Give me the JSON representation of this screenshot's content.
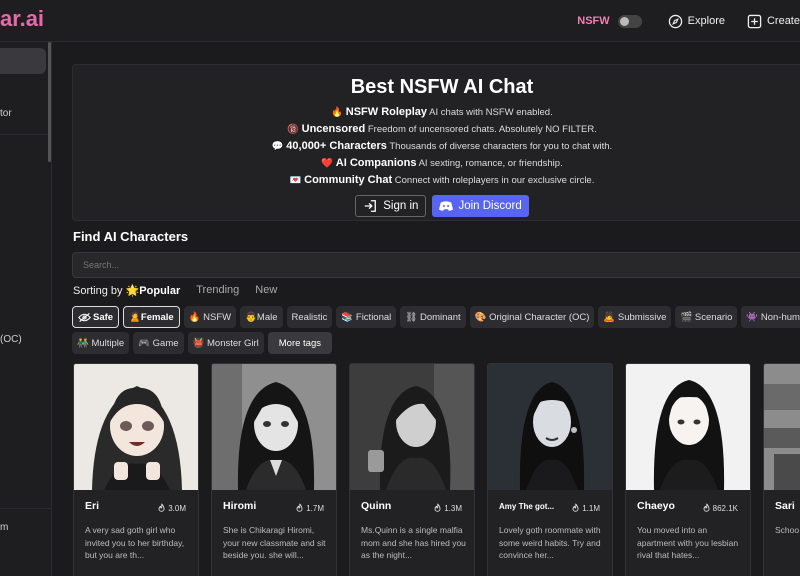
{
  "brand": {
    "logo_text": "ar.ai"
  },
  "topbar": {
    "nsfw_label": "NSFW",
    "explore_label": "Explore",
    "create_label": "Create"
  },
  "sidebar": {
    "label_1": "tor",
    "label_2": "(OC)",
    "label_3": "m"
  },
  "hero": {
    "title": "Best NSFW AI Chat",
    "features": [
      {
        "emoji": "🔥",
        "title": "NSFW Roleplay",
        "desc": "AI chats with NSFW enabled."
      },
      {
        "emoji": "🔞",
        "title": "Uncensored",
        "desc": "Freedom of uncensored chats. Absolutely NO FILTER."
      },
      {
        "emoji": "💬",
        "title": "40,000+ Characters",
        "desc": "Thousands of diverse characters for you to chat with."
      },
      {
        "emoji": "❤️",
        "title": "AI Companions",
        "desc": "AI sexting, romance, or friendship."
      },
      {
        "emoji": "💌",
        "title": "Community Chat",
        "desc": "Connect with roleplayers in our exclusive circle."
      }
    ],
    "signin_label": "Sign in",
    "discord_label": "Join Discord"
  },
  "find": {
    "title": "Find AI Characters",
    "search_placeholder": "Search..."
  },
  "sorting": {
    "prefix": "Sorting by",
    "active": "🌟Popular",
    "options": [
      "Trending",
      "New"
    ]
  },
  "tags_row1": [
    "Safe",
    "🙎Female",
    "🔥 NSFW",
    "👨Male",
    "Realistic",
    "📚 Fictional",
    "⛓ Dominant",
    "🎨 Original Character (OC)",
    "🙇 Submissive",
    "🎬 Scenario",
    "👾 Non-human"
  ],
  "tags_row2": [
    "👬 Multiple",
    "🎮 Game",
    "👹 Monster Girl"
  ],
  "more_tags_label": "More tags",
  "cards": [
    {
      "name": "Eri",
      "count": "3.0M",
      "desc": "A very sad goth girl who invited you to her birthday, but you are th..."
    },
    {
      "name": "Hiromi",
      "count": "1.7M",
      "desc": "She is Chikaragi Hiromi, your new classmate and sit beside you. she will..."
    },
    {
      "name": "Quinn",
      "count": "1.3M",
      "desc": "Ms.Quinn is a single malfia mom and she has hired you as the night..."
    },
    {
      "name": "Amy The got...",
      "count": "1.1M",
      "desc": "Lovely goth roommate with some weird habits. Try and convince her..."
    },
    {
      "name": "Chaeyo",
      "count": "862.1K",
      "desc": "You moved into an apartment with you lesbian rival that hates..."
    },
    {
      "name": "Sari",
      "count": "",
      "desc": "Schoo presid"
    }
  ]
}
